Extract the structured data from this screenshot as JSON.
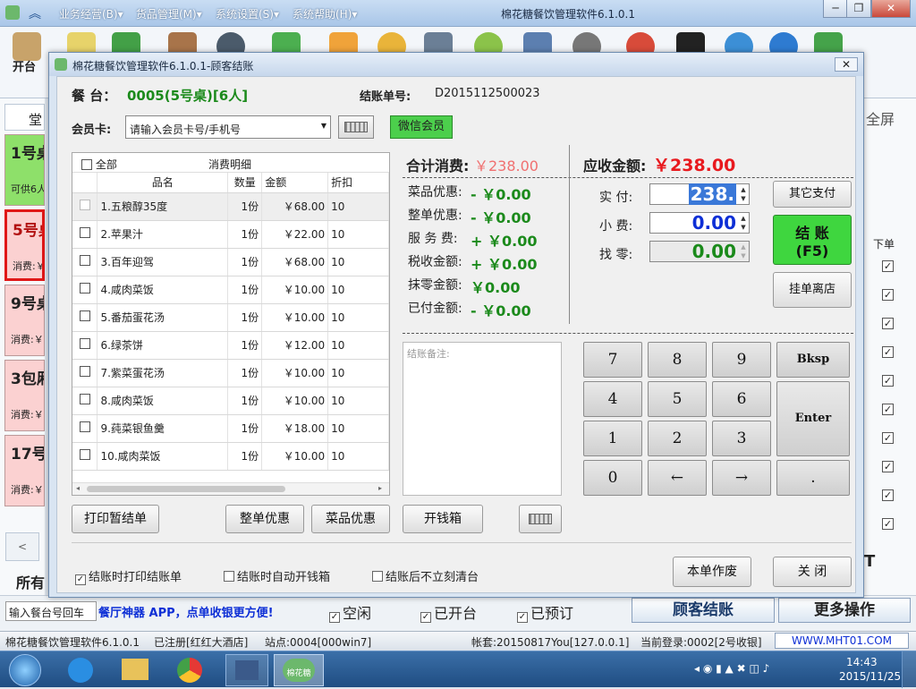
{
  "main": {
    "menus": [
      "业务经营(B)▾",
      "货品管理(M)▾",
      "系统设置(S)▾",
      "系统帮助(H)▾"
    ],
    "title": "棉花糖餐饮管理软件6.1.0.1",
    "toolbar_first": "开台",
    "fullscreen": "全屏",
    "tab_partial": "堂",
    "tiles": [
      {
        "name": "1号桌",
        "sub": "可供6人"
      },
      {
        "name": "5号桌",
        "sub": "消费:￥"
      },
      {
        "name": "9号桌",
        "sub": "消费:￥"
      },
      {
        "name": "3包厢",
        "sub": "消费:￥"
      },
      {
        "name": "17号",
        "sub": "消费:￥"
      }
    ],
    "right_header": "下单",
    "bottom": {
      "label_all": "所有",
      "table_input": "输入餐台号回车",
      "promo": "餐厅神器 APP，点单收银更方便!",
      "filter_free": "空闲",
      "filter_open": "已开台",
      "filter_reserved": "已预订",
      "btn_settle": "顾客结账",
      "btn_more": "更多操作",
      "partial_t": "T"
    },
    "status": {
      "app": "棉花糖餐饮管理软件6.1.0.1",
      "registered": "已注册[红红大酒店]",
      "station": "站点:0004[000win7]",
      "account": "帐套:20150817You[127.0.0.1]",
      "login": "当前登录:0002[2号收银]",
      "website": "WWW.MHT01.COM"
    },
    "taskbar": {
      "time": "14:43",
      "date": "2015/11/25",
      "app_label": "棉花糖"
    }
  },
  "dialog": {
    "title": "棉花糖餐饮管理软件6.1.0.1-顾客结账",
    "table_label": "餐 台：",
    "table_value": "0005(5号桌)[6人]",
    "bill_label": "结账单号:",
    "bill_value": "D2015112500023",
    "member_label": "会员卡:",
    "member_placeholder": "请输入会员卡号/手机号",
    "wechat_member": "微信会员",
    "list": {
      "all_label": "全部",
      "detail_label": "消费明细",
      "headers": [
        "品名",
        "数量",
        "金额",
        "折扣"
      ],
      "items": [
        {
          "name": "1.五粮醇35度",
          "qty": "1份",
          "amount": "￥68.00",
          "discount": "10"
        },
        {
          "name": "2.苹果汁",
          "qty": "1份",
          "amount": "￥22.00",
          "discount": "10"
        },
        {
          "name": "3.百年迎驾",
          "qty": "1份",
          "amount": "￥68.00",
          "discount": "10"
        },
        {
          "name": "4.咸肉菜饭",
          "qty": "1份",
          "amount": "￥10.00",
          "discount": "10"
        },
        {
          "name": "5.番茄蛋花汤",
          "qty": "1份",
          "amount": "￥10.00",
          "discount": "10"
        },
        {
          "name": "6.绿茶饼",
          "qty": "1份",
          "amount": "￥12.00",
          "discount": "10"
        },
        {
          "name": "7.紫菜蛋花汤",
          "qty": "1份",
          "amount": "￥10.00",
          "discount": "10"
        },
        {
          "name": "8.咸肉菜饭",
          "qty": "1份",
          "amount": "￥10.00",
          "discount": "10"
        },
        {
          "name": "9.莼菜银鱼羹",
          "qty": "1份",
          "amount": "￥18.00",
          "discount": "10"
        },
        {
          "name": "10.咸肉菜饭",
          "qty": "1份",
          "amount": "￥10.00",
          "discount": "10"
        }
      ]
    },
    "total_label": "合计消费:",
    "total_value": "￥238.00",
    "receivable_label": "应收金额:",
    "receivable_value": "￥238.00",
    "breakdown": [
      {
        "label": "菜品优惠:",
        "value": "- ￥0.00"
      },
      {
        "label": "整单优惠:",
        "value": "- ￥0.00"
      },
      {
        "label": "服 务 费:",
        "value": "+ ￥0.00"
      },
      {
        "label": "税收金额:",
        "value": "+ ￥0.00"
      },
      {
        "label": "抹零金额:",
        "value": "￥0.00"
      },
      {
        "label": "已付金额:",
        "value": "- ￥0.00"
      }
    ],
    "paid_label": "实  付:",
    "paid_value": "238.",
    "tip_label": "小  费:",
    "tip_value": "0.00",
    "change_label": "找  零:",
    "change_value": "0.00",
    "btn_other_pay": "其它支付",
    "btn_checkout": "结 账",
    "btn_checkout_key": "(F5)",
    "btn_hang": "挂单离店",
    "note_placeholder": "结账备注:",
    "keypad": [
      "7",
      "8",
      "9",
      "Bksp",
      "4",
      "5",
      "6",
      "Enter",
      "1",
      "2",
      "3",
      "0",
      "←",
      "→",
      "."
    ],
    "btn_print_temp": "打印暂结单",
    "btn_bill_discount": "整单优惠",
    "btn_item_discount": "菜品优惠",
    "btn_drawer": "开钱箱",
    "opt_print": "结账时打印结账单",
    "opt_drawer": "结账时自动开钱箱",
    "opt_noclear": "结账后不立刻清台",
    "btn_void": "本单作废",
    "btn_close": "关 闭"
  },
  "colors": {
    "red": "#e8191e",
    "green": "#1b8a1b",
    "blue": "#0d2fd6",
    "wechat": "#4ccf4c",
    "checkout": "#3fd63f"
  }
}
